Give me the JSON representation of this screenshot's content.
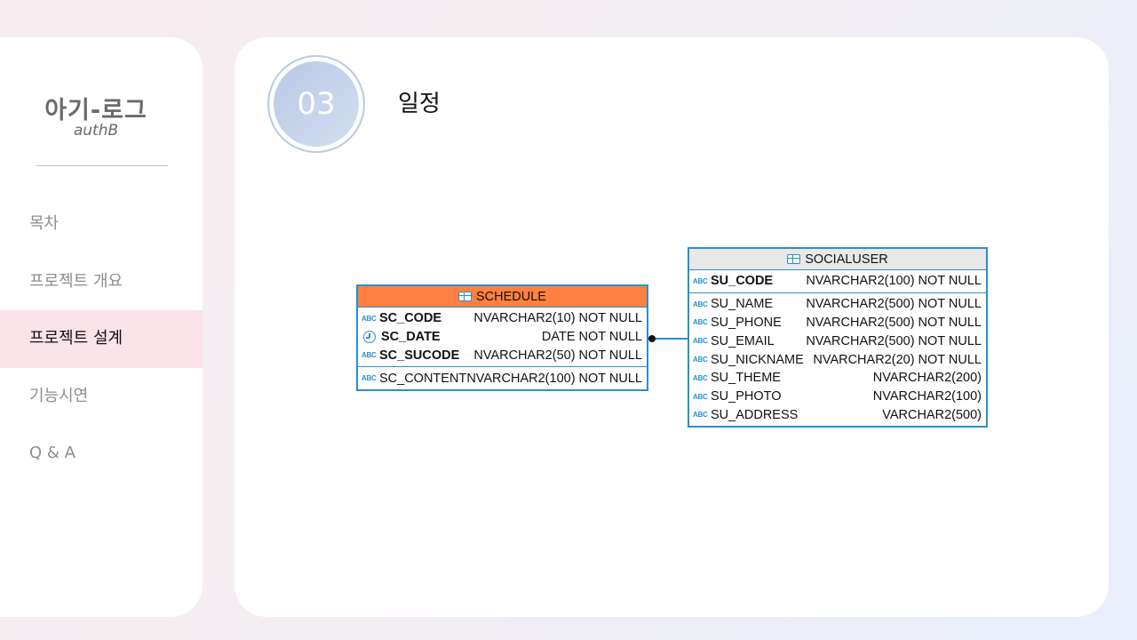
{
  "sidebar": {
    "logo_main": "아기-로그",
    "logo_sub": "authB",
    "items": [
      {
        "label": "목차"
      },
      {
        "label": "프로젝트 개요"
      },
      {
        "label": "프로젝트 설계"
      },
      {
        "label": "기능시연"
      },
      {
        "label": "Q & A"
      }
    ],
    "active_index": 2
  },
  "main": {
    "section_number": "03",
    "section_title": "일정"
  },
  "diagram": {
    "schedule": {
      "name": "SCHEDULE",
      "header_color": "#ff8040",
      "pk_columns": [
        {
          "icon": "abc-icon",
          "icon_text": "ABC",
          "name": "SC_CODE",
          "type": "NVARCHAR2(10) NOT NULL"
        },
        {
          "icon": "clock-icon",
          "icon_text": "",
          "name": "SC_DATE",
          "type": "DATE NOT NULL"
        },
        {
          "icon": "abc-icon",
          "icon_text": "ABC",
          "name": "SC_SUCODE",
          "type": "NVARCHAR2(50) NOT NULL"
        }
      ],
      "columns": [
        {
          "icon": "abc-icon",
          "icon_text": "ABC",
          "name": "SC_CONTENT",
          "type": "NVARCHAR2(100) NOT NULL"
        }
      ]
    },
    "socialuser": {
      "name": "SOCIALUSER",
      "header_color": "#e8e8e8",
      "pk_columns": [
        {
          "icon": "abc-icon",
          "icon_text": "ABC",
          "name": "SU_CODE",
          "type": "NVARCHAR2(100) NOT NULL"
        }
      ],
      "columns": [
        {
          "icon": "abc-icon",
          "icon_text": "ABC",
          "name": "SU_NAME",
          "type": "NVARCHAR2(500) NOT NULL"
        },
        {
          "icon": "abc-icon",
          "icon_text": "ABC",
          "name": "SU_PHONE",
          "type": "NVARCHAR2(500) NOT NULL"
        },
        {
          "icon": "abc-icon",
          "icon_text": "ABC",
          "name": "SU_EMAIL",
          "type": "NVARCHAR2(500) NOT NULL"
        },
        {
          "icon": "abc-icon",
          "icon_text": "ABC",
          "name": "SU_NICKNAME",
          "type": "NVARCHAR2(20) NOT NULL"
        },
        {
          "icon": "abc-icon",
          "icon_text": "ABC",
          "name": "SU_THEME",
          "type": "NVARCHAR2(200)"
        },
        {
          "icon": "abc-icon",
          "icon_text": "ABC",
          "name": "SU_PHOTO",
          "type": "NVARCHAR2(100)"
        },
        {
          "icon": "abc-icon",
          "icon_text": "ABC",
          "name": "SU_ADDRESS",
          "type": "VARCHAR2(500)"
        }
      ]
    },
    "relation": {
      "from": "SCHEDULE",
      "to": "SOCIALUSER"
    }
  }
}
